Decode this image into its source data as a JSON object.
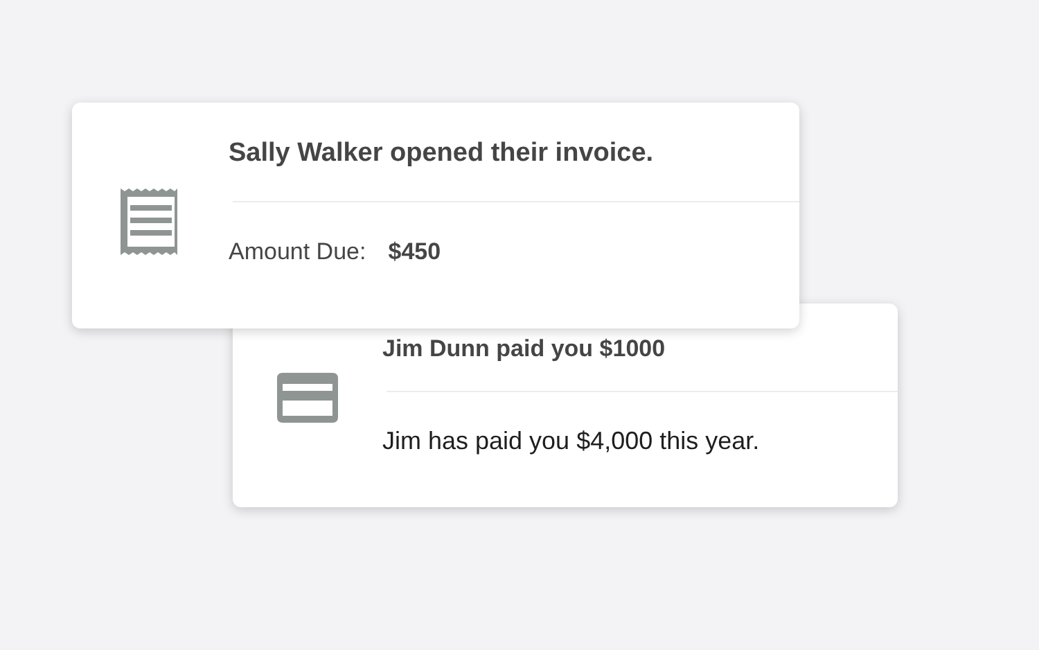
{
  "notifications": [
    {
      "kind": "invoice",
      "title": "Sally Walker opened their invoice.",
      "detail_label": "Amount Due:",
      "detail_value": "$450"
    },
    {
      "kind": "payment",
      "title": "Jim Dunn paid you $1000",
      "body": "Jim has paid you $4,000 this year."
    }
  ]
}
